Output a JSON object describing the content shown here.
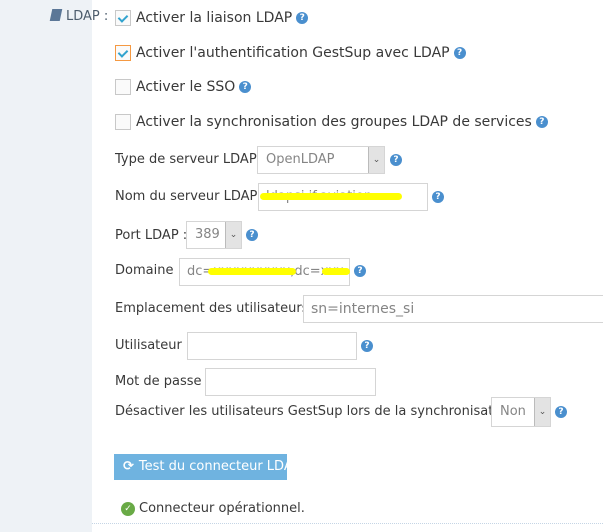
{
  "section": {
    "label": "LDAP :",
    "icon": "book-icon"
  },
  "checkboxes": [
    {
      "label": "Activer la liaison LDAP",
      "checked": true,
      "help": true
    },
    {
      "label": "Activer l'authentification GestSup avec LDAP",
      "checked": true,
      "help": true
    },
    {
      "label": "Activer le SSO",
      "checked": false,
      "help": true
    },
    {
      "label": "Activer la synchronisation des groupes LDAP de services",
      "checked": false,
      "help": true
    }
  ],
  "fields": {
    "server_type": {
      "label": "Type de serveur LDAP :",
      "value": "OpenLDAP"
    },
    "server_name": {
      "label": "Nom du serveur LDAP :",
      "value": "ldapsi.if.aviation"
    },
    "port": {
      "label": "Port LDAP :",
      "value": "389"
    },
    "domain": {
      "label": "Domaine :",
      "value": "dc=xxxxxxxxxx,dc=xxx"
    },
    "users_location": {
      "label": "Emplacement des utilisateurs :",
      "value": "sn=internes_si"
    },
    "user": {
      "label": "Utilisateur :",
      "value": ""
    },
    "password": {
      "label": "Mot de passe :",
      "value": ""
    },
    "disable_users": {
      "label": "Désactiver les utilisateurs GestSup lors de la synchronisation :",
      "value": "Non"
    }
  },
  "help_glyph": "?",
  "test_button": {
    "label": "Test du connecteur LDAP",
    "icon": "refresh-icon"
  },
  "status": {
    "text": "Connecteur opérationnel.",
    "icon": "check-circle-icon",
    "color": "#69aa46"
  },
  "colors": {
    "accent": "#6fb3e0",
    "help": "#4a8fce",
    "sidebar": "#eef2f6"
  }
}
